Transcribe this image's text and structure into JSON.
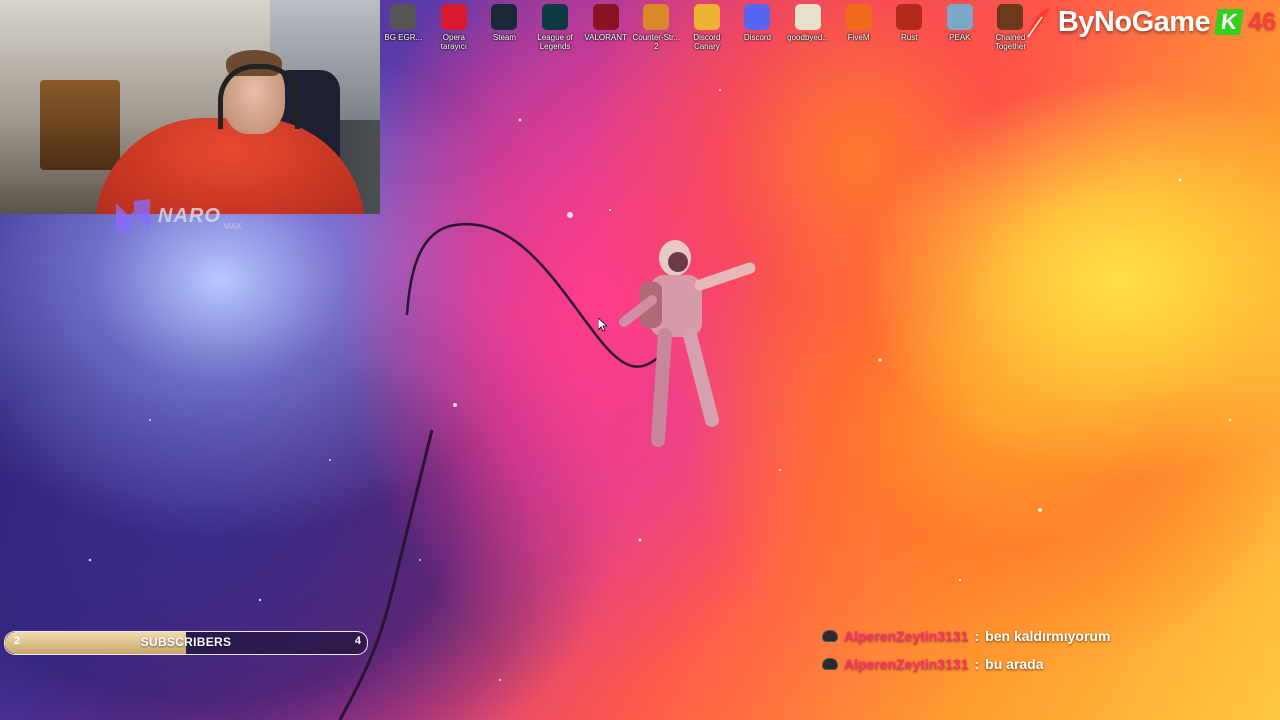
{
  "desktop_icons": [
    {
      "label": "BG EGR...",
      "icon": "bg-egr-icon",
      "color": "#555555"
    },
    {
      "label": "Opera tarayıcı",
      "icon": "opera-icon",
      "color": "#d8192e"
    },
    {
      "label": "Steam",
      "icon": "steam-icon",
      "color": "#1b2838"
    },
    {
      "label": "League of Legends",
      "icon": "league-of-legends-icon",
      "color": "#0d3a42"
    },
    {
      "label": "VALORANT",
      "icon": "valorant-icon",
      "color": "#8a1222"
    },
    {
      "label": "Counter-Str... 2",
      "icon": "counter-strike-icon",
      "color": "#d9892a"
    },
    {
      "label": "Discord Canary",
      "icon": "discord-canary-icon",
      "color": "#f0b232"
    },
    {
      "label": "Discord",
      "icon": "discord-icon",
      "color": "#5865f2"
    },
    {
      "label": "goodbyed...",
      "icon": "goodbye-icon",
      "color": "#e8e0c8"
    },
    {
      "label": "FiveM",
      "icon": "fivem-icon",
      "color": "#f26a1b"
    },
    {
      "label": "Rust",
      "icon": "rust-icon",
      "color": "#b22a1c"
    },
    {
      "label": "PEAK",
      "icon": "peak-icon",
      "color": "#7aa8c8"
    },
    {
      "label": "Chained Together",
      "icon": "chained-together-icon",
      "color": "#6b3a1e"
    }
  ],
  "overlay": {
    "webcam": {
      "icon": "webcam-feed"
    },
    "naro_logo": {
      "text": "NARO",
      "subtext": "MAX"
    },
    "bynogame": {
      "brand": "ByNoGame",
      "k_badge": "K",
      "count": "46",
      "accent": "#33d11e",
      "count_color": "#ff3b3b"
    },
    "subscribers": {
      "label": "SUBSCRIBERS",
      "current": "2",
      "goal": "4",
      "progress": 0.5
    }
  },
  "chat": [
    {
      "user": "AlperenZeytin3131",
      "separator": ":",
      "message": "ben kaldırmıyorum"
    },
    {
      "user": "AlperenZeytin3131",
      "separator": ":",
      "message": "bu arada"
    }
  ],
  "wallpaper": {
    "subject": "astronaut-in-nebula"
  }
}
